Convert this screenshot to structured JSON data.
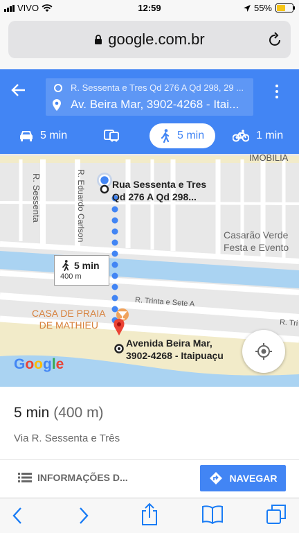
{
  "status_bar": {
    "carrier": "VIVO",
    "time": "12:59",
    "battery": "55%",
    "battery_level": 0.55
  },
  "browser": {
    "url": "google.com.br"
  },
  "directions": {
    "origin": "R. Sessenta e Tres Qd 276 A Qd 298, 29 ...",
    "destination": "Av. Beira Mar, 3902-4268 - Itai...",
    "modes": [
      {
        "name": "car",
        "label": "5 min"
      },
      {
        "name": "transit",
        "label": ""
      },
      {
        "name": "walk",
        "label": "5 min",
        "active": true
      },
      {
        "name": "bike",
        "label": "1 min"
      }
    ]
  },
  "map": {
    "streets": {
      "sessenta": "R. Sessenta",
      "carlson": "R. Eduardo Carlson",
      "trinta": "R. Trinta e Sete A",
      "trinta_right": "R. Tri"
    },
    "places": {
      "imobiliaria": "IMOBILIÁ",
      "casarao_line1": "Casarão Verde",
      "casarao_line2": "Festa e Evento",
      "casa_line1": "CASA DE PRAIA",
      "casa_line2": "DE MATHIEU"
    },
    "start_label_line1": "Rua Sessenta e Tres",
    "start_label_line2": "Qd 276 A Qd 298...",
    "end_label_line1": "Avenida Beira Mar,",
    "end_label_line2": "3902-4268 - Itaipuaçu",
    "callout_time": "5 min",
    "callout_distance": "400 m",
    "logo": "Google",
    "logo_colors": [
      "#4285f4",
      "#ea4335",
      "#fbbc05",
      "#4285f4",
      "#34a853",
      "#ea4335"
    ]
  },
  "summary": {
    "time": "5 min",
    "distance": "(400 m)",
    "via": "Via R. Sessenta e Três"
  },
  "actions": {
    "info_label": "INFORMAÇÕES D...",
    "navigate_label": "NAVEGAR"
  },
  "colors": {
    "accent": "#4285f4",
    "pin": "#ea4335",
    "water": "#aad3f2",
    "beach": "#f2ebc9"
  }
}
